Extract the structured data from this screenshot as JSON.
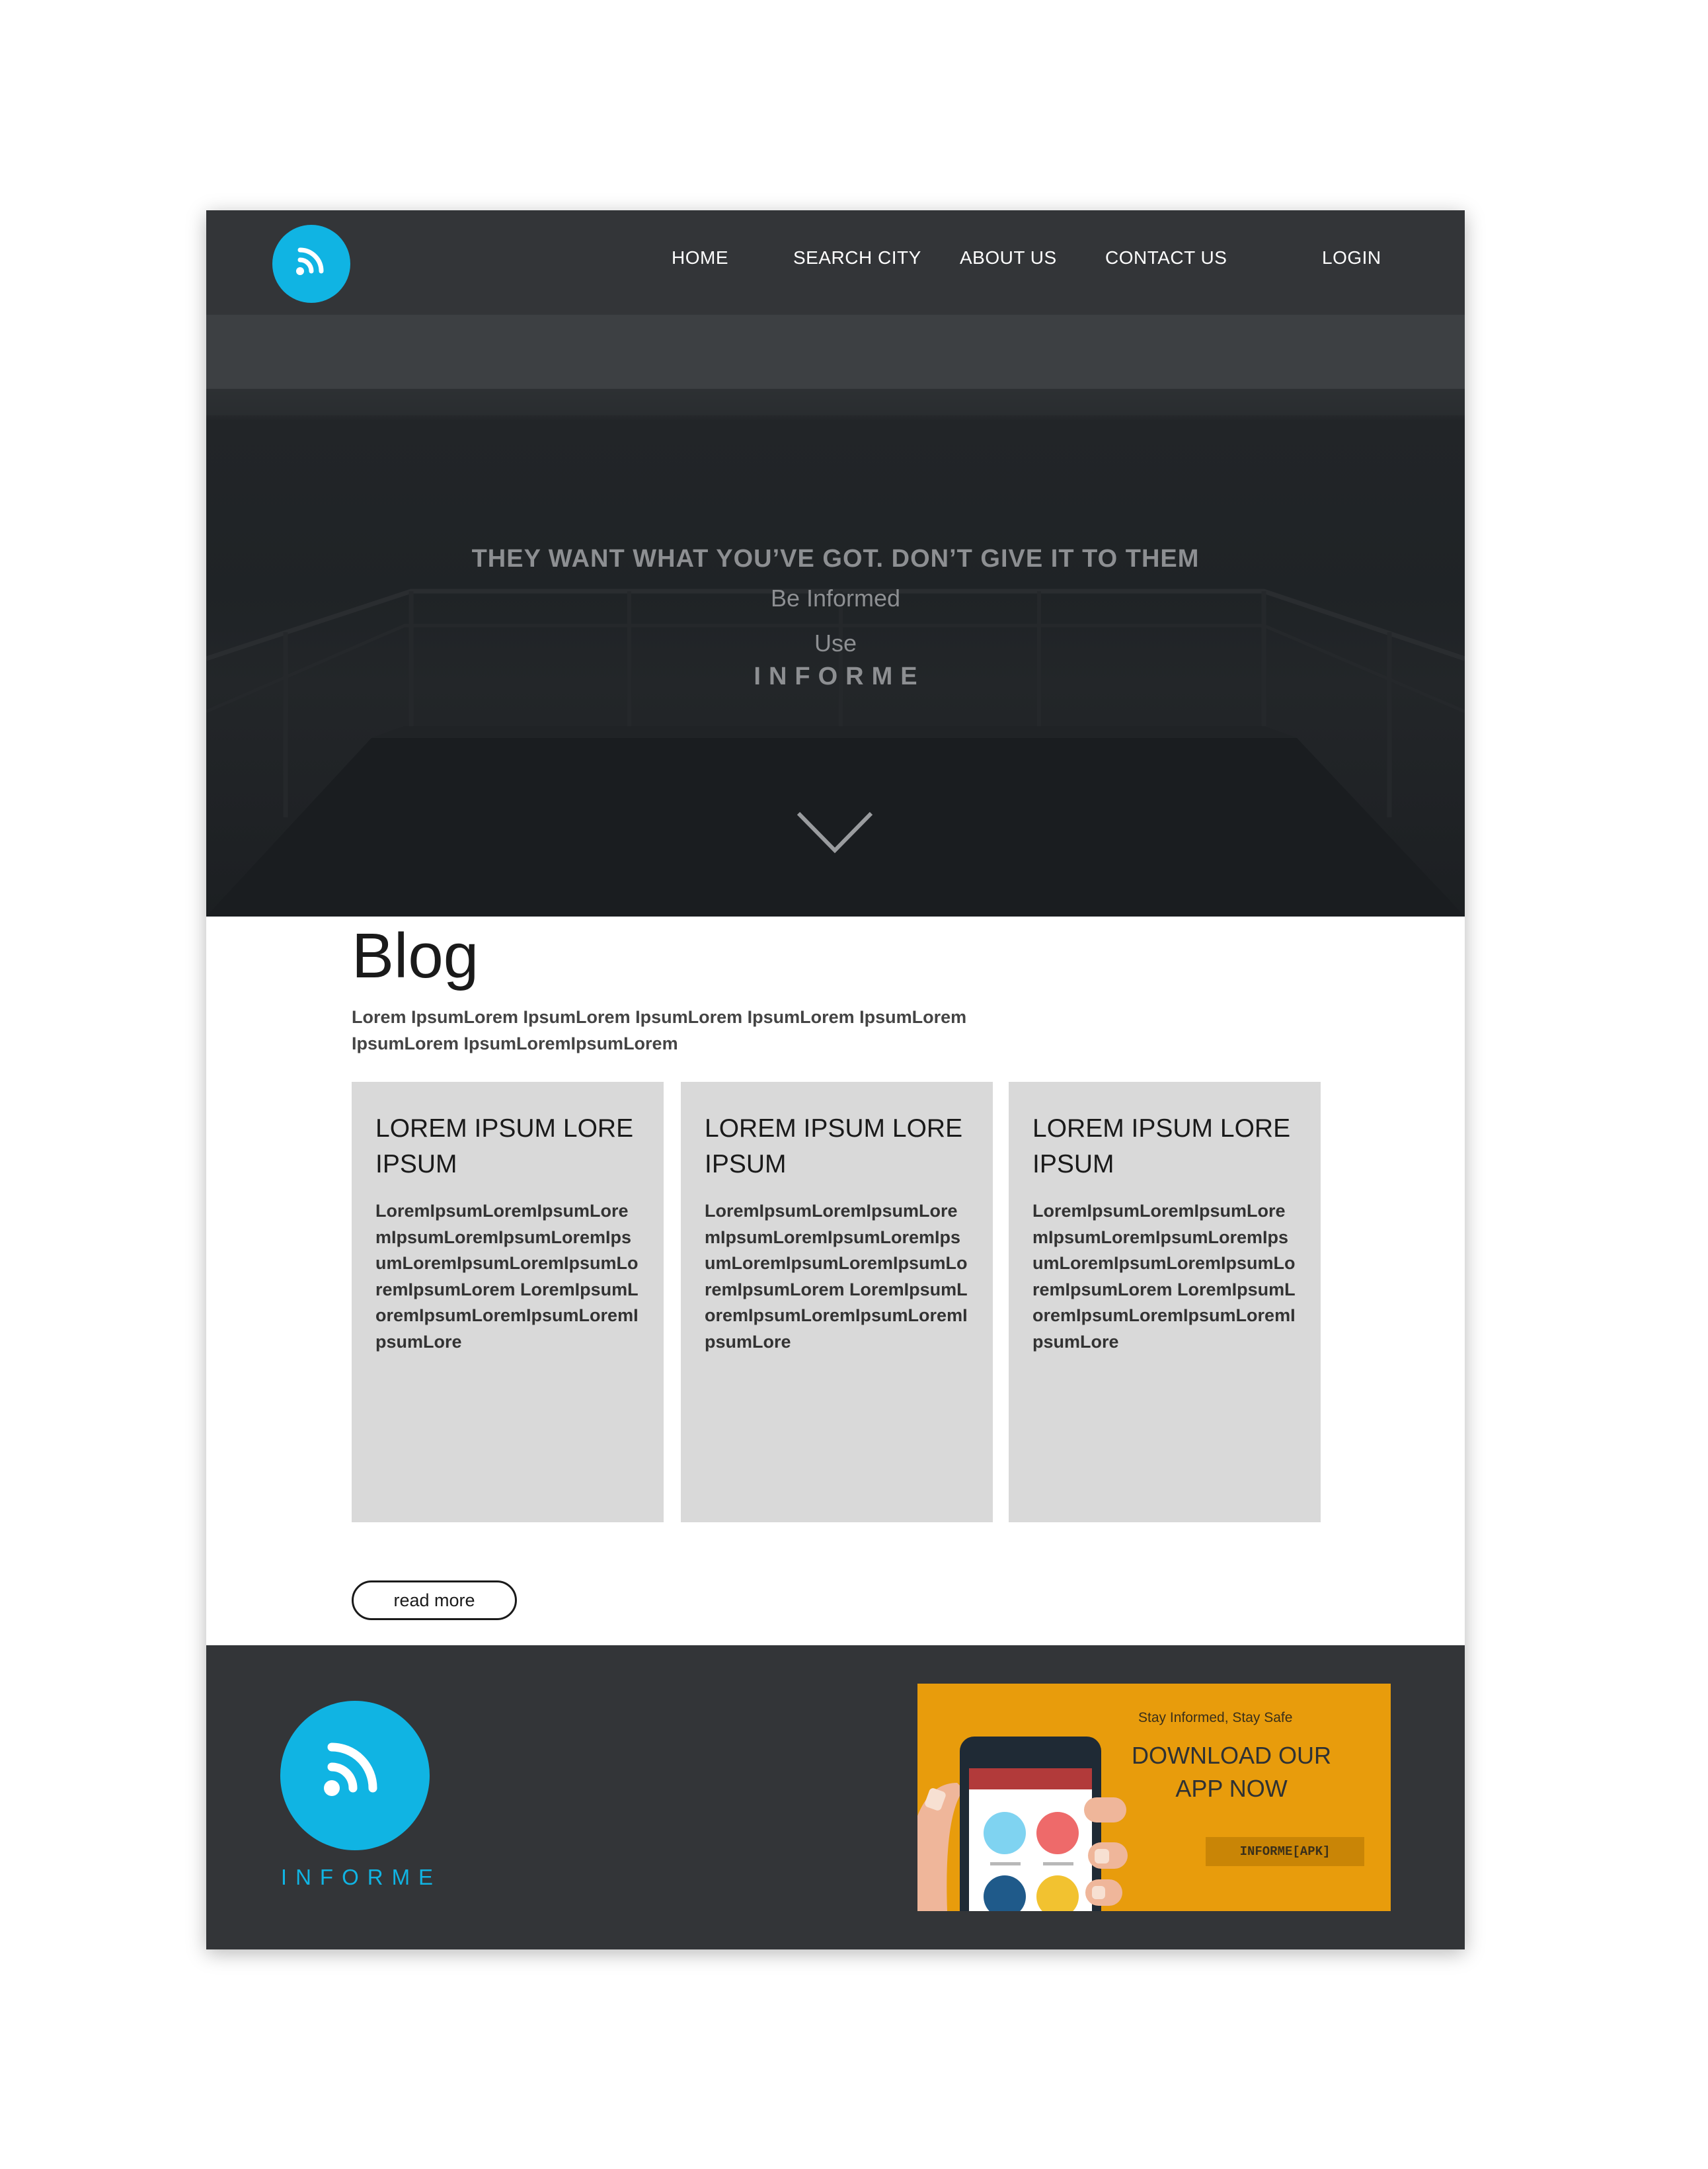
{
  "colors": {
    "brand": "#10b4e3",
    "nav_background": "#333538",
    "footer_background": "#333538",
    "card_background": "#d9d9d9",
    "banner_background": "#e89c0c"
  },
  "nav": {
    "logo_icon": "rss-feed-icon",
    "links": [
      "HOME",
      "SEARCH CITY",
      "ABOUT US",
      "CONTACT US"
    ],
    "login_label": "LOGIN"
  },
  "hero": {
    "headline": "THEY WANT WHAT YOU’VE GOT. DON’T GIVE IT TO THEM",
    "subline": "Be Informed",
    "use_text": "Use",
    "brand": "INFORME",
    "scroll_icon": "chevron-down-icon"
  },
  "blog": {
    "title": "Blog",
    "intro": "Lorem IpsumLorem IpsumLorem IpsumLorem IpsumLorem IpsumLorem IpsumLorem IpsumLoremIpsumLorem",
    "cards": [
      {
        "title": "LOREM IPSUM LORE IPSUM",
        "body": "LoremIpsumLoremIpsumLoremIpsumLoremIpsumLoremIpsumLoremIpsumLoremIpsumLoremIpsumLorem LoremIpsumLoremIpsumLoremIpsumLoremIpsumLore"
      },
      {
        "title": "LOREM IPSUM LORE IPSUM",
        "body": "LoremIpsumLoremIpsumLoremIpsumLoremIpsumLoremIpsumLoremIpsumLoremIpsumLoremIpsumLorem LoremIpsumLoremIpsumLoremIpsumLoremIpsumLore"
      },
      {
        "title": "LOREM IPSUM LORE IPSUM",
        "body": "LoremIpsumLoremIpsumLoremIpsumLoremIpsumLoremIpsumLoremIpsumLoremIpsumLoremIpsumLorem LoremIpsumLoremIpsumLoremIpsumLoremIpsumLore"
      }
    ],
    "read_more_label": "read more"
  },
  "footer": {
    "logo_icon": "rss-feed-icon",
    "brand": "INFORME",
    "banner": {
      "tagline": "Stay Informed, Stay Safe",
      "title": "DOWNLOAD OUR APP NOW",
      "button_label": "INFORME[APK]",
      "illustration": "hand-holding-phone-icon"
    }
  }
}
